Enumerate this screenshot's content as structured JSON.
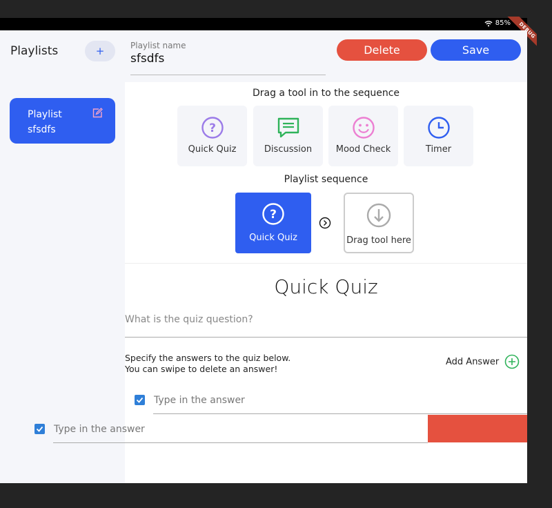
{
  "status": {
    "battery": "85%"
  },
  "debug": {
    "label": "DEBUG"
  },
  "sidebar": {
    "title": "Playlists",
    "add_label": "+",
    "items": [
      {
        "label_line1": "Playlist",
        "label_line2": "sfsdfs"
      }
    ]
  },
  "header": {
    "name_label": "Playlist name",
    "name_value": "sfsdfs",
    "delete_label": "Delete",
    "save_label": "Save"
  },
  "tools": {
    "heading": "Drag a tool in to the sequence",
    "items": [
      {
        "label": "Quick Quiz",
        "icon": "question-icon",
        "color": "#9b7be8"
      },
      {
        "label": "Discussion",
        "icon": "chat-icon",
        "color": "#2fb35a"
      },
      {
        "label": "Mood Check",
        "icon": "smiley-icon",
        "color": "#ec7fd2"
      },
      {
        "label": "Timer",
        "icon": "clock-icon",
        "color": "#2f5ef0"
      }
    ]
  },
  "sequence": {
    "heading": "Playlist sequence",
    "items": [
      {
        "label": "Quick Quiz",
        "icon": "question-icon"
      }
    ],
    "drop_label": "Drag tool here"
  },
  "quiz": {
    "title": "Quick Quiz",
    "question_placeholder": "What is the quiz question?",
    "help_line1": "Specify the answers to the quiz below.",
    "help_line2": "You can swipe to delete an answer!",
    "add_answer_label": "Add Answer",
    "answers": [
      {
        "placeholder": "Type in the answer",
        "checked": true
      },
      {
        "placeholder": "Type in the answer",
        "checked": true
      }
    ]
  },
  "colors": {
    "accent": "#2f5ef0",
    "danger": "#e5513f",
    "checkbox": "#2f7fd8"
  }
}
